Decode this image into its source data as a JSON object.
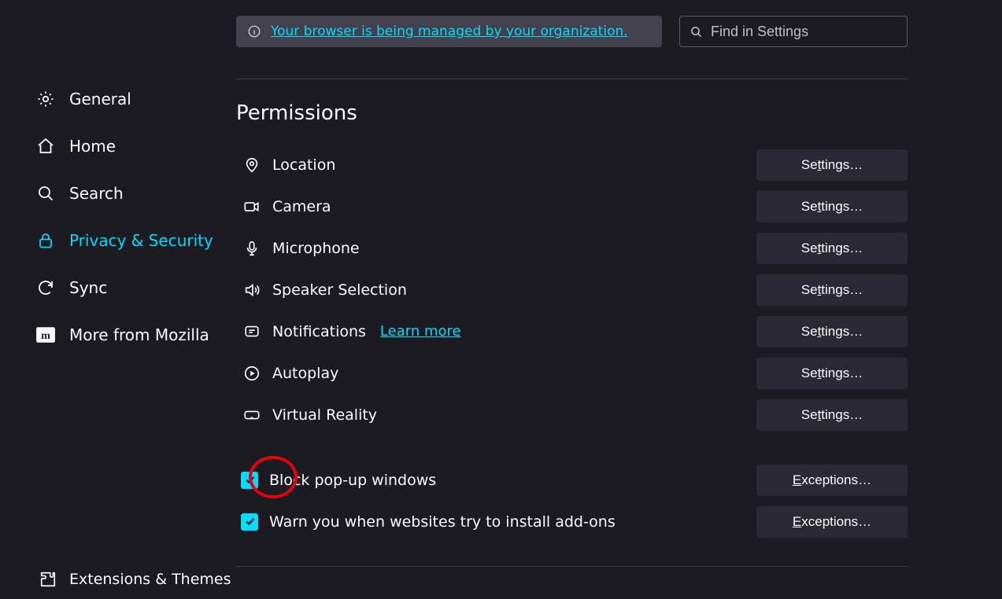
{
  "colors": {
    "accent": "#00ddff",
    "bg": "#1c1b22",
    "btn": "#2b2a33",
    "banner": "#42414d"
  },
  "sidebar": {
    "items": [
      {
        "label": "General",
        "icon": "gear-icon"
      },
      {
        "label": "Home",
        "icon": "home-icon"
      },
      {
        "label": "Search",
        "icon": "search-icon"
      },
      {
        "label": "Privacy & Security",
        "icon": "lock-icon",
        "selected": true
      },
      {
        "label": "Sync",
        "icon": "sync-icon"
      },
      {
        "label": "More from Mozilla",
        "icon": "mozilla-icon"
      }
    ],
    "footer": {
      "label": "Extensions & Themes",
      "icon": "puzzle-icon"
    }
  },
  "banner": {
    "text": "Your browser is being managed by your organization."
  },
  "search": {
    "placeholder": "Find in Settings"
  },
  "section": {
    "title": "Permissions"
  },
  "permissions": [
    {
      "label": "Location",
      "icon": "location-icon",
      "button": "Settings…"
    },
    {
      "label": "Camera",
      "icon": "camera-icon",
      "button": "Settings…"
    },
    {
      "label": "Microphone",
      "icon": "mic-icon",
      "button": "Settings…"
    },
    {
      "label": "Speaker Selection",
      "icon": "speaker-icon",
      "button": "Settings…"
    },
    {
      "label": "Notifications",
      "icon": "notification-icon",
      "button": "Settings…",
      "link": "Learn more"
    },
    {
      "label": "Autoplay",
      "icon": "autoplay-icon",
      "button": "Settings…"
    },
    {
      "label": "Virtual Reality",
      "icon": "vr-icon",
      "button": "Settings…"
    }
  ],
  "checks": [
    {
      "label": "Block pop-up windows",
      "checked": true,
      "button": "Exceptions…",
      "accesskey": "B"
    },
    {
      "label": "Warn you when websites try to install add-ons",
      "checked": true,
      "button": "Exceptions…",
      "accesskey": "W"
    }
  ]
}
